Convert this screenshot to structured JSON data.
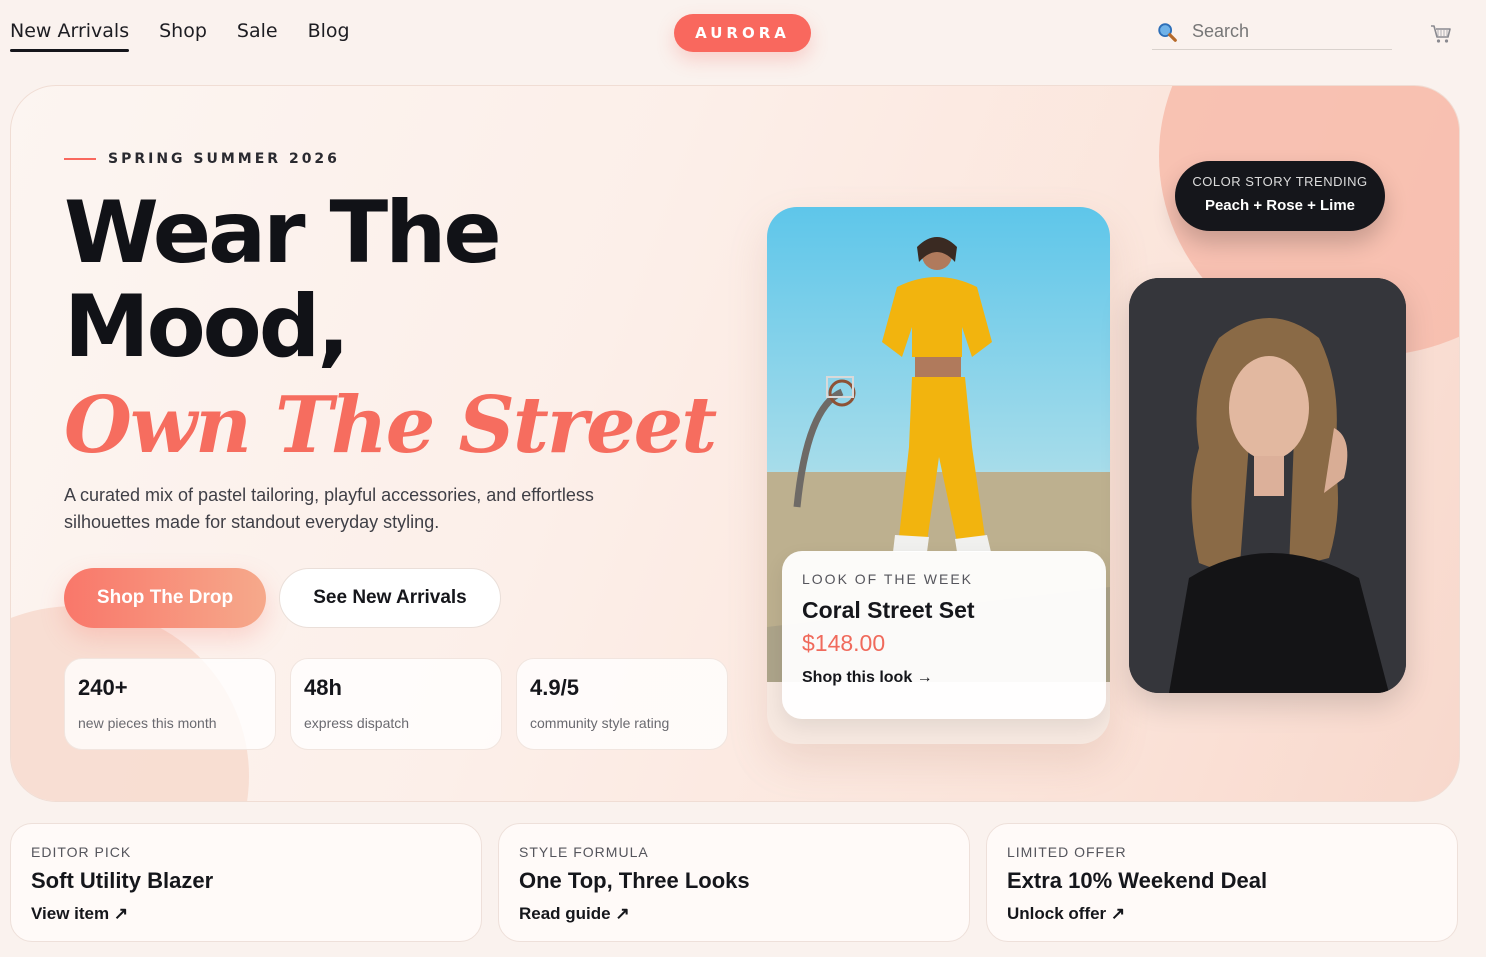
{
  "nav": {
    "links": [
      {
        "label": "New Arrivals",
        "active": true
      },
      {
        "label": "Shop"
      },
      {
        "label": "Sale"
      },
      {
        "label": "Blog"
      }
    ],
    "logo": "AURORA",
    "search_placeholder": "Search",
    "cart_icon": "cart-icon",
    "search_icon": "search-icon"
  },
  "hero": {
    "eyebrow": "SPRING SUMMER 2026",
    "headline_line1": "Wear The",
    "headline_line2": "Mood,",
    "headline_accent": "Own The Street",
    "description": "A curated mix of pastel tailoring, playful accessories, and effortless silhouettes made for standout everyday styling.",
    "primary_cta": "Shop The Drop",
    "secondary_cta": "See New Arrivals",
    "stats": [
      {
        "value": "240+",
        "label": "new pieces this month"
      },
      {
        "value": "48h",
        "label": "express dispatch"
      },
      {
        "value": "4.9/5",
        "label": "community style rating"
      }
    ],
    "look": {
      "kicker": "LOOK OF THE WEEK",
      "title": "Coral Street Set",
      "price": "$148.00",
      "action": "Shop this look →"
    },
    "trend": {
      "kicker": "COLOR STORY TRENDING",
      "value": "Peach + Rose + Lime"
    }
  },
  "cards": [
    {
      "kicker": "EDITOR PICK",
      "title": "Soft Utility Blazer",
      "action": "View item ↗"
    },
    {
      "kicker": "STYLE FORMULA",
      "title": "One Top, Three Looks",
      "action": "Read guide ↗"
    },
    {
      "kicker": "LIMITED OFFER",
      "title": "Extra 10% Weekend Deal",
      "action": "Unlock offer ↗"
    }
  ],
  "colors": {
    "accent": "#f9685e",
    "dark": "#15161b",
    "background": "#faf2ee"
  }
}
